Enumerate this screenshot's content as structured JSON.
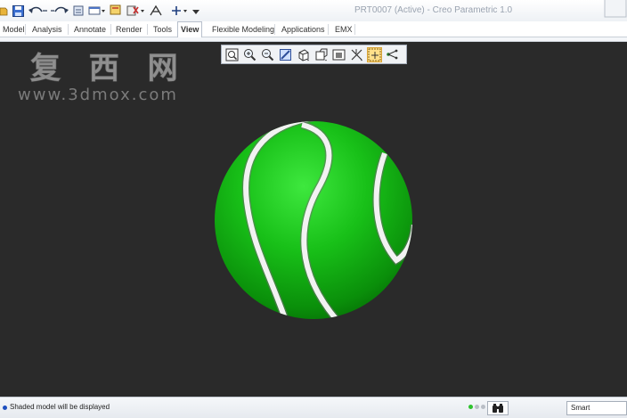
{
  "window": {
    "title": "PRT0007 (Active) - Creo Parametric 1.0"
  },
  "quick_access": [
    {
      "icon": "open-icon"
    },
    {
      "icon": "save-icon"
    },
    {
      "icon": "undo-icon"
    },
    {
      "icon": "redo-icon"
    },
    {
      "icon": "regenerate-icon"
    },
    {
      "icon": "windows-icon"
    },
    {
      "icon": "close-window-icon"
    },
    {
      "icon": "sketch-icon"
    },
    {
      "icon": "coordinate-system-icon"
    },
    {
      "icon": "dropdown-icon"
    },
    {
      "icon": "customize-icon"
    }
  ],
  "ribbon": {
    "tabs": [
      {
        "label": "Model"
      },
      {
        "label": "Analysis"
      },
      {
        "label": "Annotate"
      },
      {
        "label": "Render"
      },
      {
        "label": "Tools"
      },
      {
        "label": "View",
        "active": true
      },
      {
        "label": "Flexible Modeling"
      },
      {
        "label": "Applications"
      },
      {
        "label": "EMX"
      }
    ]
  },
  "watermark": {
    "text": "复 西 网",
    "url": "www.3dmox.com"
  },
  "view_toolbar": [
    {
      "icon": "refit-icon"
    },
    {
      "icon": "zoom-in-icon"
    },
    {
      "icon": "zoom-out-icon"
    },
    {
      "icon": "repaint-icon"
    },
    {
      "icon": "display-style-icon"
    },
    {
      "icon": "saved-orientations-icon"
    },
    {
      "icon": "view-manager-icon"
    },
    {
      "icon": "datum-display-icon"
    },
    {
      "icon": "spin-center-icon",
      "active": true
    },
    {
      "icon": "annotation-display-icon"
    }
  ],
  "model": {
    "name": "tennis ball",
    "color": "#18c018",
    "seam_color": "#f2f2f2"
  },
  "status_bar": {
    "message": "Shaded model will be displayed",
    "filter": "Smart"
  },
  "colors": {
    "graphics_background": "#2a2a2a",
    "status_light_on": "#2ec32e",
    "status_light_off": "#b9bec6"
  }
}
